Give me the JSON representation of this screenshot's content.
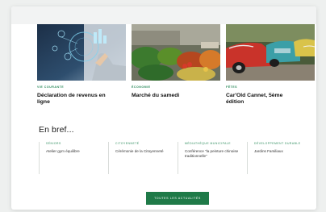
{
  "news": [
    {
      "category": "Vie Courante",
      "title": "Déclaration de revenus en ligne",
      "image": "person-using-digital-tax-interface-photo"
    },
    {
      "category": "Économie",
      "title": "Marché du samedi",
      "image": "vegetable-market-stall-photo"
    },
    {
      "category": "Fêtes",
      "title": "Car'Old Cannet, 5ème édition",
      "image": "vintage-cars-row-photo"
    }
  ],
  "brief": {
    "title": "En bref...",
    "items": [
      {
        "category": "Séniors",
        "text": "Atelier gym équilibre"
      },
      {
        "category": "Citoyenneté",
        "text": "Cérémonie de la Citoyenneté"
      },
      {
        "category": "Médiathèque municipale",
        "text": "Conférence \"la peinture chinoise traditionnelle\""
      },
      {
        "category": "Développement durable",
        "text": "Jardins Familiaux"
      }
    ]
  },
  "cta": {
    "label": "Toutes les actualités"
  }
}
